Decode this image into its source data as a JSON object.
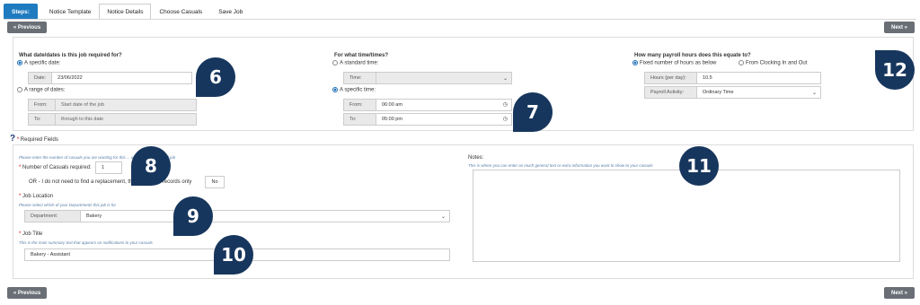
{
  "steps": {
    "label": "Steps:",
    "tabs": [
      "Notice Template",
      "Notice Details",
      "Choose Casuals",
      "Save Job"
    ]
  },
  "nav": {
    "previous": "Previous",
    "next": "Next"
  },
  "date_section": {
    "title": "What date/dates is this job required for?",
    "specific_date_label": "A specific date:",
    "date_field_label": "Date:",
    "date_value": "23/06/2022",
    "range_label": "A range of dates:",
    "from_label": "From:",
    "from_placeholder": "Start date of the job",
    "to_label": "To:",
    "to_placeholder": "through to this date"
  },
  "time_section": {
    "title": "For what time/times?",
    "standard_label": "A standard time:",
    "time_field_label": "Time:",
    "specific_label": "A specific time:",
    "from_label": "From:",
    "from_value": "06:00 am",
    "to_label": "To:",
    "to_value": "05:00 pm"
  },
  "payroll_section": {
    "title": "How many payroll hours does this equate to?",
    "fixed_label": "Fixed number of hours as below",
    "clocking_label": "From Clocking In and Out",
    "hours_label": "Hours (per day):",
    "hours_value": "10.5",
    "activity_label": "Payroll Activity:",
    "activity_value": "Ordinary Time"
  },
  "required_fields": "Required Fields",
  "casuals": {
    "hint": "Please enter the number of casuals you are wanting for this ... only if it is an internal job",
    "label": "Number of Casuals required:",
    "value": "1",
    "or_text": "OR - I do not need to find a replacement, this is fo... nal records only",
    "toggle": "No"
  },
  "location": {
    "label": "Job Location",
    "hint": "Please select which of your Departments this job is for",
    "dept_label": "Department:",
    "dept_value": "Bakery"
  },
  "job_title": {
    "label": "Job Title",
    "hint": "This is the main summary text that appears on notifications to your casuals",
    "value": "Bakery - Assistant"
  },
  "notes": {
    "label": "Notes:",
    "hint": "This is where you can enter as much general text or extra information you want to show to your casuals"
  },
  "markers": [
    "6",
    "7",
    "8",
    "9",
    "10",
    "11",
    "12"
  ],
  "colors": {
    "tab_accent": "#1f7bbf",
    "marker": "#17365d",
    "button": "#6a6f75"
  }
}
